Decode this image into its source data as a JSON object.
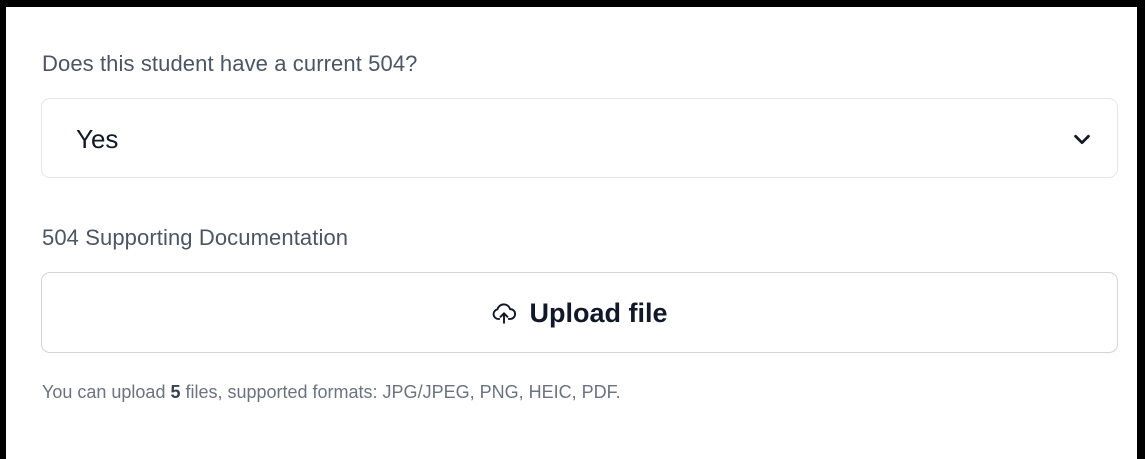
{
  "question": {
    "label": "Does this student have a current 504?",
    "selected_value": "Yes"
  },
  "documentation": {
    "label": "504 Supporting Documentation",
    "upload_button_label": "Upload file",
    "hint_prefix": "You can upload ",
    "hint_count": "5",
    "hint_suffix": " files, supported formats: JPG/JPEG, PNG, HEIC, PDF."
  },
  "icons": {
    "select_icon": "chevron-down-icon",
    "upload_icon": "cloud-upload-icon"
  }
}
